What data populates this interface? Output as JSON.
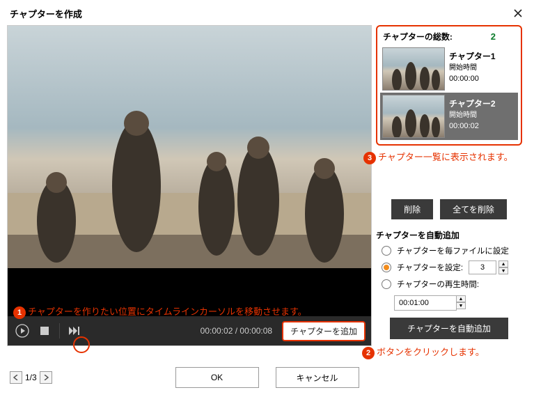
{
  "titlebar": {
    "title": "チャプターを作成"
  },
  "player": {
    "current_time": "00:00:02",
    "duration": "00:00:08",
    "add_chapter_label": "チャプターを追加"
  },
  "chapter_panel": {
    "count_label": "チャプターの総数:",
    "count_value": "2",
    "start_time_label": "開始時間",
    "chapters": [
      {
        "title": "チャプター1",
        "time": "00:00:00"
      },
      {
        "title": "チャプター2",
        "time": "00:00:02"
      }
    ]
  },
  "buttons": {
    "delete": "削除",
    "delete_all": "全てを削除",
    "auto_add": "チャプターを自動追加"
  },
  "auto_section": {
    "title": "チャプターを自動追加",
    "opt_per_file": "チャプターを毎ファイルに設定",
    "opt_set_count": "チャプターを設定:",
    "opt_play_time": "チャプターの再生時間:",
    "count_value": "3",
    "time_value": "00:01:00"
  },
  "footer": {
    "page": "1/3",
    "ok": "OK",
    "cancel": "キャンセル"
  },
  "annotations": {
    "a1": "チャプターを作りたい位置にタイムラインカーソルを移動させます。",
    "a2": "ボタンをクリックします。",
    "a3": "チャプター一覧に表示されます。"
  }
}
